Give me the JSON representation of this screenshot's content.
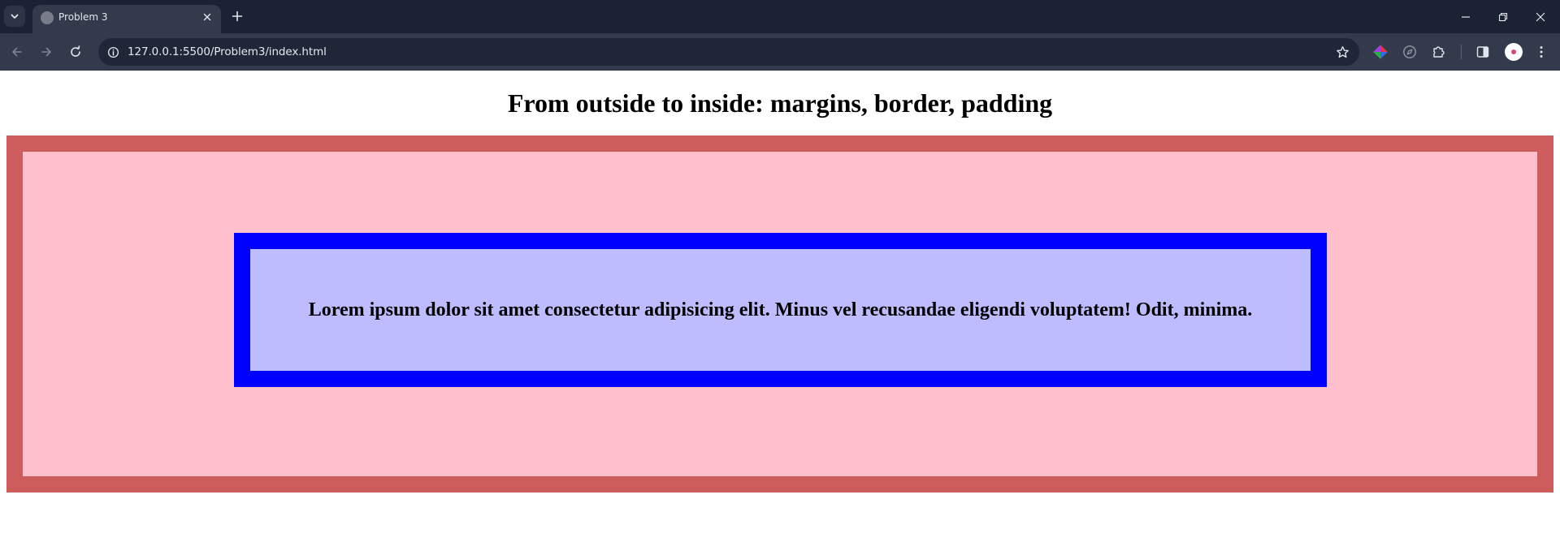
{
  "browser": {
    "tab": {
      "title": "Problem 3"
    },
    "address_bar": {
      "url": "127.0.0.1:5500/Problem3/index.html"
    },
    "icons": {
      "tab_search": "chevron-down-icon",
      "favicon": "globe-icon",
      "tab_close": "close-icon",
      "new_tab": "plus-icon",
      "back": "arrow-left-icon",
      "forward": "arrow-right-icon",
      "reload": "reload-icon",
      "site_info": "info-icon",
      "bookmark": "star-icon",
      "extensions": [
        "color-wheel-icon",
        "compass-icon",
        "puzzle-icon"
      ],
      "side_panel": "side-panel-icon",
      "menu": "kebab-menu-icon",
      "window": [
        "minimize-icon",
        "restore-icon",
        "close-icon"
      ]
    }
  },
  "page": {
    "heading": "From outside to inside: margins, border, padding",
    "inner_text": "Lorem ipsum dolor sit amet consectetur adipisicing elit. Minus vel recusandae eligendi voluptatem! Odit, minima.",
    "colors": {
      "outer_border": "#cd5c5c",
      "outer_background": "#ffc0cb",
      "inner_border": "#0000ff",
      "inner_background": "#bcbcff"
    }
  }
}
